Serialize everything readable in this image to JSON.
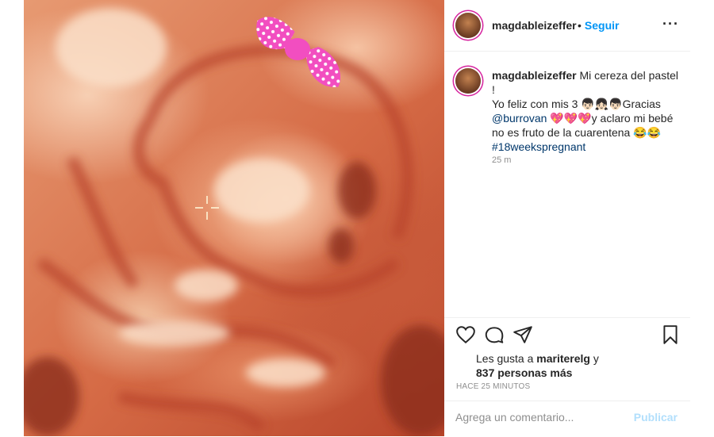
{
  "header": {
    "username": "magdableizeffer",
    "separator": "•",
    "follow_label": "Seguir",
    "more_icon": "more-icon"
  },
  "caption": {
    "username": "magdableizeffer",
    "text_line1": "Mi cereza del pastel !",
    "text_line2a": "Yo feliz con mis 3 ",
    "emoji_kids": "👦🏻👧🏻👦🏻",
    "text_line2b": "Gracias",
    "mention": "@burrovan",
    "emoji_hearts": "💖💖💖",
    "text_line3": "y aclaro mi bebé no es fruto de la cuarentena ",
    "emoji_laugh": "😂😂",
    "hashtag": "#18weekspregnant",
    "time": "25 m"
  },
  "actions": {
    "like_icon": "heart-icon",
    "comment_icon": "comment-icon",
    "share_icon": "paper-plane-icon",
    "save_icon": "bookmark-icon"
  },
  "likes": {
    "prefix": "Les gusta a ",
    "user": "mariterelg",
    "suffix": " y",
    "count_text": "837 personas más"
  },
  "time_ago": "HACE 25 MINUTOS",
  "comment_box": {
    "placeholder": "Agrega un comentario...",
    "publish_label": "Publicar"
  },
  "colors": {
    "link_blue": "#0095f6",
    "publish_disabled": "#b2dffc",
    "bow_pink": "#f24ec0"
  }
}
